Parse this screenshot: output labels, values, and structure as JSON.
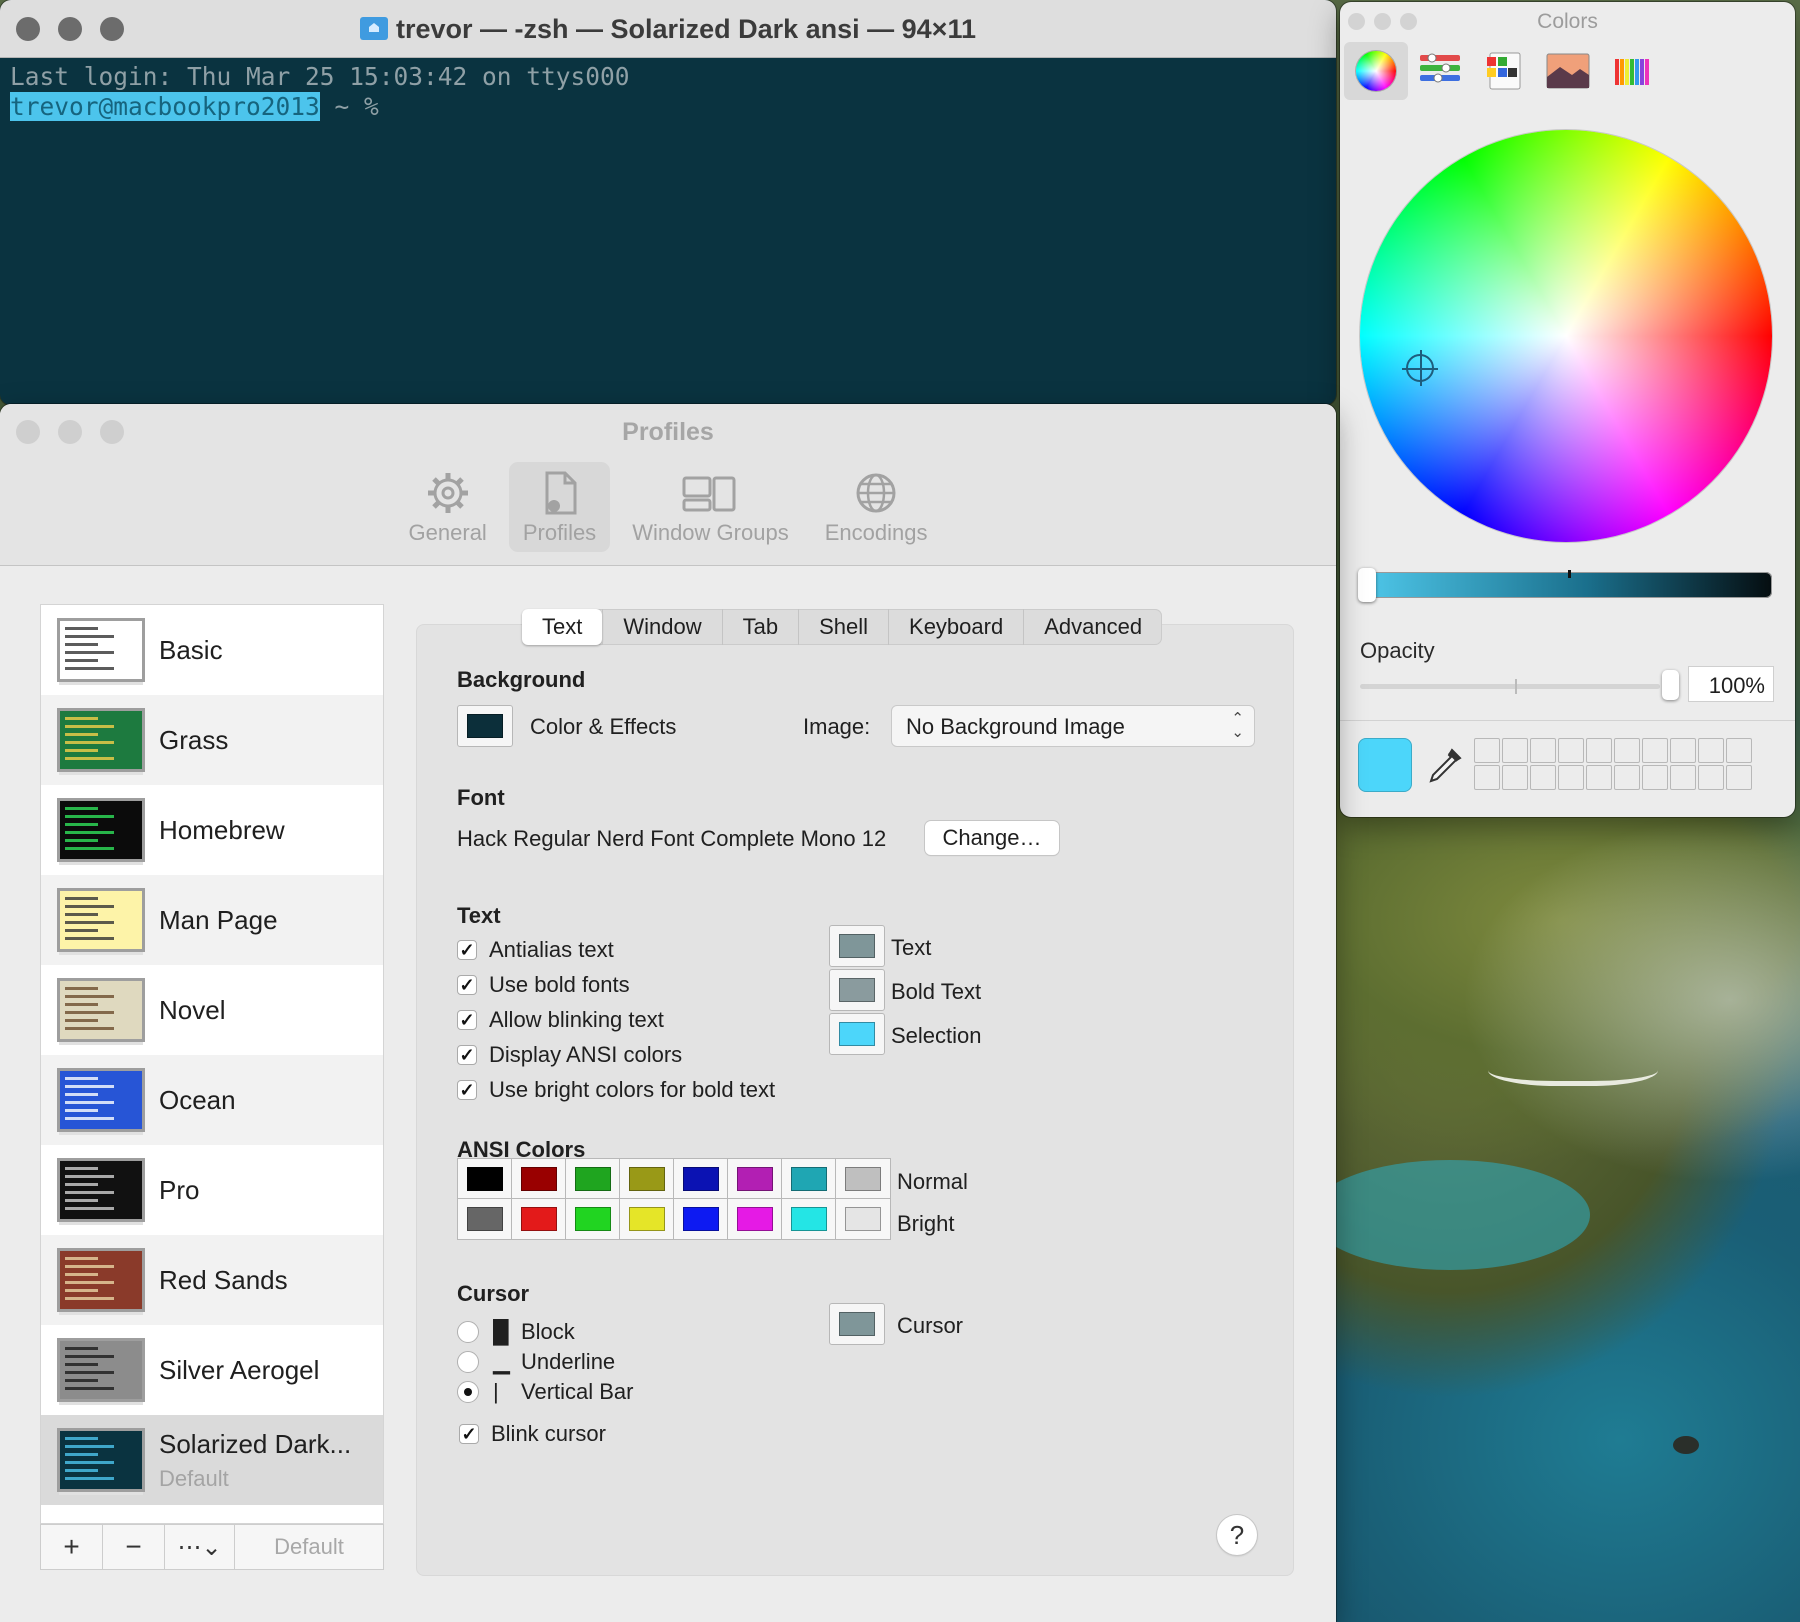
{
  "terminal": {
    "title": "trevor — -zsh — Solarized Dark ansi — 94×11",
    "last_login": "Last login: Thu Mar 25 15:03:42 on ttys000",
    "prompt_user": "trevor@macbookpro2013",
    "prompt_rest": " ~ %",
    "colors": {
      "background": "#0a3340",
      "text": "#8fa0a6",
      "selection": "#4cc4ec"
    }
  },
  "colors_panel": {
    "title": "Colors",
    "modes": [
      "color-wheel-icon",
      "color-sliders-icon",
      "color-palettes-icon",
      "image-palettes-icon",
      "pencils-icon"
    ],
    "opacity_label": "Opacity",
    "opacity_value": "100%",
    "opacity_fraction": 1.0,
    "current_color": "#4cd6fa",
    "swatch_count": 20
  },
  "profiles_window": {
    "title": "Profiles",
    "toolbar": [
      {
        "label": "General",
        "icon": "gear-icon"
      },
      {
        "label": "Profiles",
        "icon": "profile-doc-icon"
      },
      {
        "label": "Window Groups",
        "icon": "window-groups-icon"
      },
      {
        "label": "Encodings",
        "icon": "globe-icon"
      }
    ],
    "profiles": [
      {
        "name": "Basic",
        "bg": "#ffffff",
        "fg": "#333333"
      },
      {
        "name": "Grass",
        "bg": "#1d7a3f",
        "fg": "#f3d04a"
      },
      {
        "name": "Homebrew",
        "bg": "#0b0b0b",
        "fg": "#2fe05a"
      },
      {
        "name": "Man Page",
        "bg": "#fdf3a8",
        "fg": "#333333"
      },
      {
        "name": "Novel",
        "bg": "#dfd9bf",
        "fg": "#6b4c2e"
      },
      {
        "name": "Ocean",
        "bg": "#2755d6",
        "fg": "#ffffff"
      },
      {
        "name": "Pro",
        "bg": "#111111",
        "fg": "#cfcfcf"
      },
      {
        "name": "Red Sands",
        "bg": "#8a3a2a",
        "fg": "#e8d3a4"
      },
      {
        "name": "Silver Aerogel",
        "bg": "#8c8c8c",
        "fg": "#1c1c1c"
      },
      {
        "name": "Solarized Dark...",
        "bg": "#0a3340",
        "fg": "#4cc4ec",
        "sub": "Default"
      }
    ],
    "list_tools": {
      "add": "+",
      "remove": "−",
      "more": "⋯⌄",
      "default": "Default"
    },
    "tabs": [
      "Text",
      "Window",
      "Tab",
      "Shell",
      "Keyboard",
      "Advanced"
    ],
    "background": {
      "heading": "Background",
      "effects_label": "Color & Effects",
      "effects_color": "#0c2f3a",
      "image_label": "Image:",
      "image_value": "No Background Image"
    },
    "font": {
      "heading": "Font",
      "value": "Hack Regular Nerd Font Complete Mono 12",
      "change_button": "Change…"
    },
    "text": {
      "heading": "Text",
      "checks": [
        {
          "label": "Antialias text",
          "checked": true
        },
        {
          "label": "Use bold fonts",
          "checked": true
        },
        {
          "label": "Allow blinking text",
          "checked": true
        },
        {
          "label": "Display ANSI colors",
          "checked": true
        },
        {
          "label": "Use bright colors for bold text",
          "checked": true
        }
      ],
      "color_wells": [
        {
          "label": "Text",
          "color": "#7f9699"
        },
        {
          "label": "Bold Text",
          "color": "#8a9b9e"
        },
        {
          "label": "Selection",
          "color": "#4cd6fa"
        }
      ]
    },
    "ansi": {
      "heading": "ANSI Colors",
      "normal_label": "Normal",
      "bright_label": "Bright",
      "normal": [
        "#000000",
        "#990000",
        "#1fa51f",
        "#999917",
        "#0b12b3",
        "#b21fb3",
        "#1fa6b3",
        "#bfbfbf"
      ],
      "bright": [
        "#666666",
        "#e31a1a",
        "#21d421",
        "#e5e528",
        "#0d1af2",
        "#e51ae5",
        "#24e5e5",
        "#e5e5e5"
      ]
    },
    "cursor": {
      "heading": "Cursor",
      "options": [
        {
          "label": "Block",
          "glyph": "█",
          "selected": false
        },
        {
          "label": "Underline",
          "glyph": "▁",
          "selected": false
        },
        {
          "label": "Vertical Bar",
          "glyph": "|",
          "selected": true
        }
      ],
      "blink_label": "Blink cursor",
      "blink_checked": true,
      "cursor_label": "Cursor",
      "cursor_color": "#7f9699"
    },
    "help": "?"
  }
}
